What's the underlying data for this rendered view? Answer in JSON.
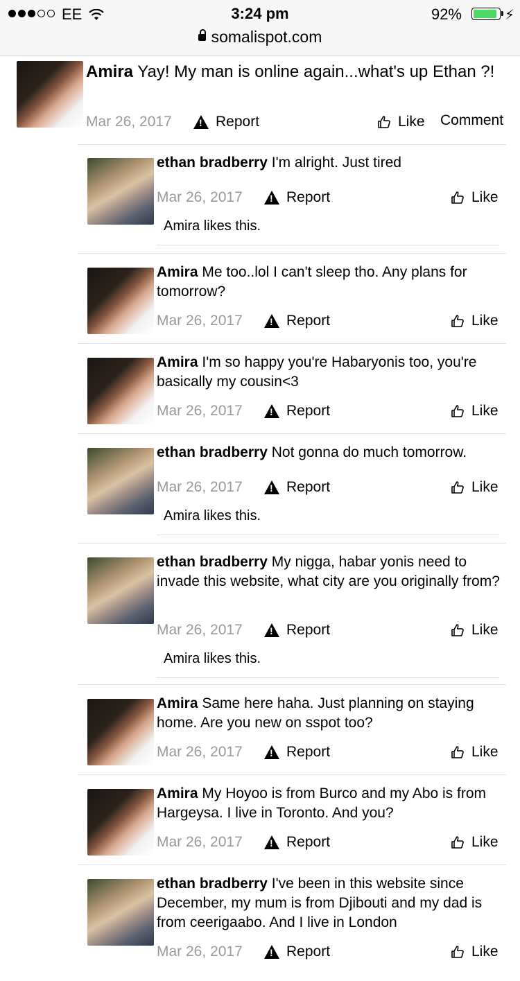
{
  "status_bar": {
    "carrier": "EE",
    "time": "3:24 pm",
    "battery": "92%",
    "battery_level": 0.92
  },
  "url_bar": {
    "domain": "somalispot.com"
  },
  "actions": {
    "report": "Report",
    "like": "Like",
    "comment": "Comment"
  },
  "likes_text": "Amira likes this.",
  "thread": {
    "author": "Amira",
    "text": "Yay! My man is online again...what's up Ethan ?!",
    "date": "Mar 26, 2017"
  },
  "replies": [
    {
      "author": "ethan bradberry",
      "text": "I'm alright. Just tired",
      "date": "Mar 26, 2017",
      "liked": true
    },
    {
      "author": "Amira",
      "text": "Me too..lol I can't sleep tho. Any plans for tomorrow?",
      "date": "Mar 26, 2017",
      "liked": false
    },
    {
      "author": "Amira",
      "text": "I'm so happy you're Habaryonis too, you're basically my cousin<3",
      "date": "Mar 26, 2017",
      "liked": false
    },
    {
      "author": "ethan bradberry",
      "text": "Not gonna do much tomorrow.",
      "date": "Mar 26, 2017",
      "liked": true
    },
    {
      "author": "ethan bradberry",
      "text": "My nigga, habar yonis need to invade this website, what city are you originally from?",
      "date": "Mar 26, 2017",
      "liked": true
    },
    {
      "author": "Amira",
      "text": "Same here haha. Just planning on staying home. Are you new on sspot too?",
      "date": "Mar 26, 2017",
      "liked": false
    },
    {
      "author": "Amira",
      "text": "My Hoyoo is from Burco and my Abo is from Hargeysa. I live in Toronto. And you?",
      "date": "Mar 26, 2017",
      "liked": false
    },
    {
      "author": "ethan bradberry",
      "text": "I've been in this website since December, my mum is from Djibouti and my dad is from ceerigaabo. And I live in London",
      "date": "Mar 26, 2017",
      "liked": false
    }
  ]
}
